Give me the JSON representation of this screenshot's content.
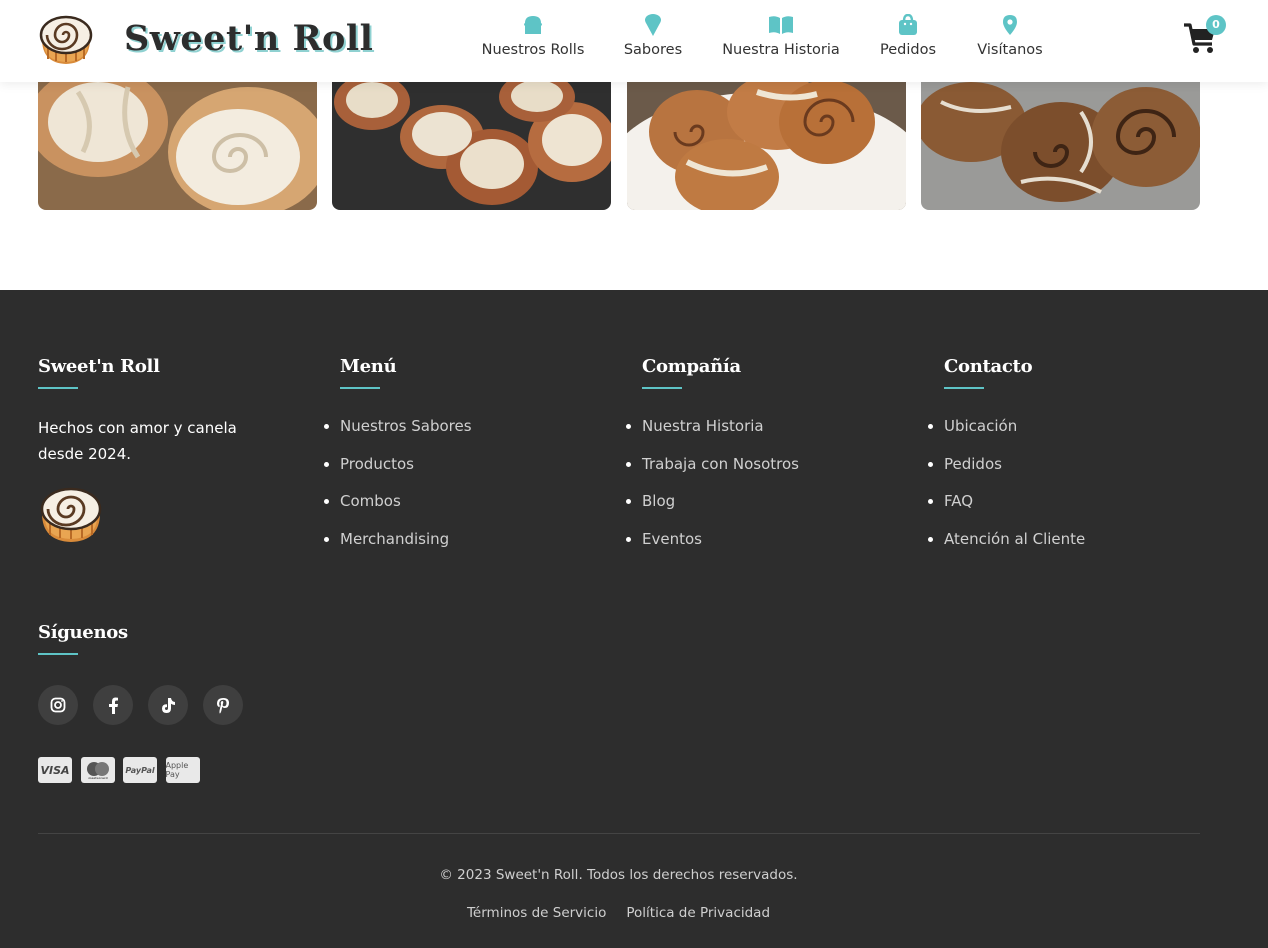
{
  "brand": {
    "name": "Sweet'n Roll",
    "logo_icon": "cinnamon-roll-icon"
  },
  "nav": {
    "items": [
      {
        "label": "Nuestros Rolls",
        "icon": "bread-icon"
      },
      {
        "label": "Sabores",
        "icon": "ice-cream-icon"
      },
      {
        "label": "Nuestra Historia",
        "icon": "book-open-icon"
      },
      {
        "label": "Pedidos",
        "icon": "shopping-bag-icon"
      },
      {
        "label": "Visítanos",
        "icon": "map-pin-icon"
      }
    ]
  },
  "cart": {
    "count": "0",
    "icon": "cart-icon"
  },
  "gallery": {
    "photos": [
      "cinnamon-rolls-photo-1",
      "cinnamon-rolls-photo-2",
      "cinnamon-rolls-photo-3",
      "cinnamon-rolls-photo-4"
    ]
  },
  "footer": {
    "about": {
      "title": "Sweet'n Roll",
      "tagline": "Hechos con amor y canela desde 2024."
    },
    "menu": {
      "title": "Menú",
      "links": [
        "Nuestros Sabores",
        "Productos",
        "Combos",
        "Merchandising"
      ]
    },
    "company": {
      "title": "Compañía",
      "links": [
        "Nuestra Historia",
        "Trabaja con Nosotros",
        "Blog",
        "Eventos"
      ]
    },
    "contact": {
      "title": "Contacto",
      "links": [
        "Ubicación",
        "Pedidos",
        "FAQ",
        "Atención al Cliente"
      ]
    },
    "follow": {
      "title": "Síguenos",
      "socials": [
        "instagram-icon",
        "facebook-icon",
        "tiktok-icon",
        "pinterest-icon"
      ]
    },
    "payments": [
      "VISA",
      "mastercard",
      "PayPal",
      "Apple Pay"
    ],
    "copyright": "© 2023 Sweet'n Roll. Todos los derechos reservados.",
    "legal": [
      "Términos de Servicio",
      "Política de Privacidad"
    ]
  },
  "colors": {
    "accent": "#5ec4c6",
    "footer_bg": "#2d2d2d",
    "text_dark": "#2d2d2d"
  }
}
